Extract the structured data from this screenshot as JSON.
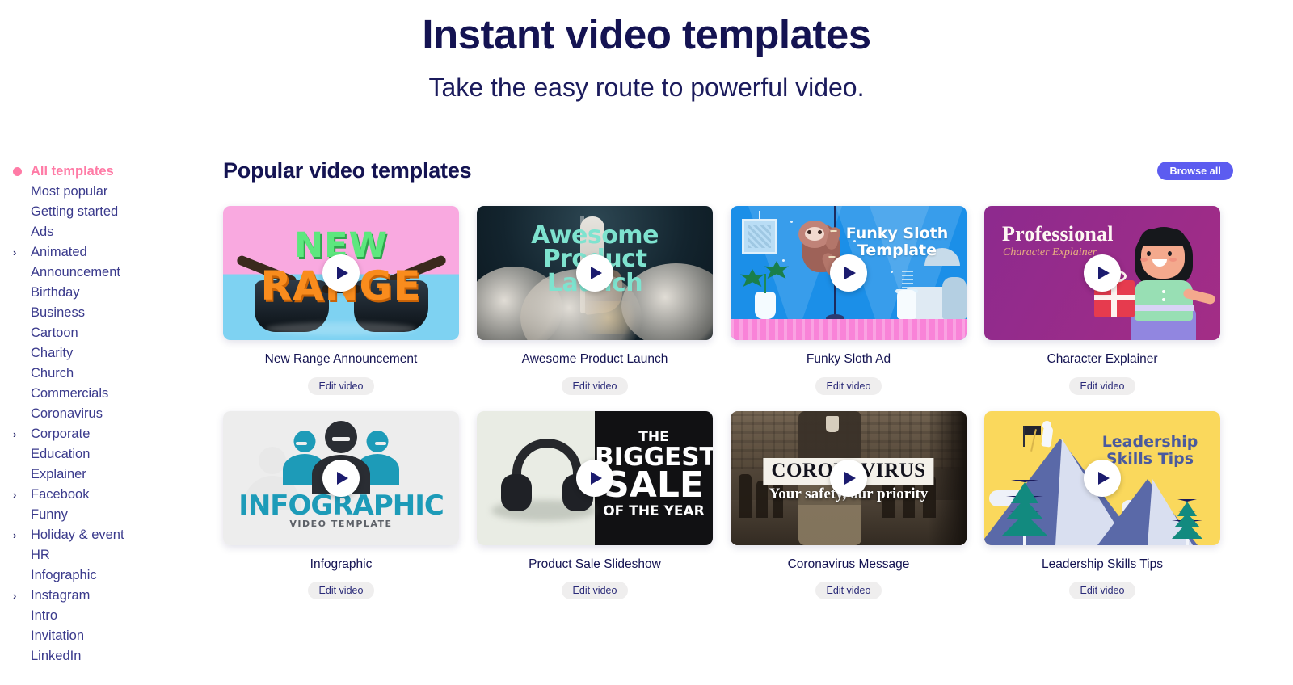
{
  "hero": {
    "title": "Instant video templates",
    "subtitle": "Take the easy route to powerful video."
  },
  "sidebar": {
    "items": [
      {
        "label": "All templates",
        "active": true,
        "expandable": false
      },
      {
        "label": "Most popular",
        "active": false,
        "expandable": false
      },
      {
        "label": "Getting started",
        "active": false,
        "expandable": false
      },
      {
        "label": "Ads",
        "active": false,
        "expandable": false
      },
      {
        "label": "Animated",
        "active": false,
        "expandable": true
      },
      {
        "label": "Announcement",
        "active": false,
        "expandable": false
      },
      {
        "label": "Birthday",
        "active": false,
        "expandable": false
      },
      {
        "label": "Business",
        "active": false,
        "expandable": false
      },
      {
        "label": "Cartoon",
        "active": false,
        "expandable": false
      },
      {
        "label": "Charity",
        "active": false,
        "expandable": false
      },
      {
        "label": "Church",
        "active": false,
        "expandable": false
      },
      {
        "label": "Commercials",
        "active": false,
        "expandable": false
      },
      {
        "label": "Coronavirus",
        "active": false,
        "expandable": false
      },
      {
        "label": "Corporate",
        "active": false,
        "expandable": true
      },
      {
        "label": "Education",
        "active": false,
        "expandable": false
      },
      {
        "label": "Explainer",
        "active": false,
        "expandable": false
      },
      {
        "label": "Facebook",
        "active": false,
        "expandable": true
      },
      {
        "label": "Funny",
        "active": false,
        "expandable": false
      },
      {
        "label": "Holiday & event",
        "active": false,
        "expandable": true
      },
      {
        "label": "HR",
        "active": false,
        "expandable": false
      },
      {
        "label": "Infographic",
        "active": false,
        "expandable": false
      },
      {
        "label": "Instagram",
        "active": false,
        "expandable": true
      },
      {
        "label": "Intro",
        "active": false,
        "expandable": false
      },
      {
        "label": "Invitation",
        "active": false,
        "expandable": false
      },
      {
        "label": "LinkedIn",
        "active": false,
        "expandable": false
      }
    ],
    "chevron_glyph": "›",
    "active_color": "#ff7ba6",
    "text_color": "#3a3a8c"
  },
  "main": {
    "section_title": "Popular video templates",
    "browse_all_label": "Browse all",
    "browse_all_color": "#5c5cf0",
    "edit_label": "Edit video",
    "cards": [
      {
        "title": "New Range Announcement",
        "art": {
          "new": "NEW",
          "range": "RANGE"
        }
      },
      {
        "title": "Awesome Product Launch",
        "art": {
          "line1": "Awesome",
          "line2": "Product",
          "line3": "Launch"
        }
      },
      {
        "title": "Funky Sloth Ad",
        "art": {
          "line1": "Funky Sloth",
          "line2": "Template"
        }
      },
      {
        "title": "Character Explainer",
        "art": {
          "line1": "Professional",
          "line2": "Character Explainer"
        }
      },
      {
        "title": "Infographic",
        "art": {
          "headline": "INFOGRAPHIC",
          "sub": "VIDEO TEMPLATE"
        }
      },
      {
        "title": "Product Sale Slideshow",
        "art": {
          "l1": "THE",
          "l2": "BIGGEST",
          "l3": "SALE",
          "l4": "OF THE YEAR"
        }
      },
      {
        "title": "Coronavirus Message",
        "art": {
          "headline": "CORONAVIRUS",
          "sub": "Your safety, our priority"
        }
      },
      {
        "title": "Leadership Skills Tips",
        "art": {
          "line1": "Leadership",
          "line2": "Skills Tips"
        }
      }
    ]
  }
}
